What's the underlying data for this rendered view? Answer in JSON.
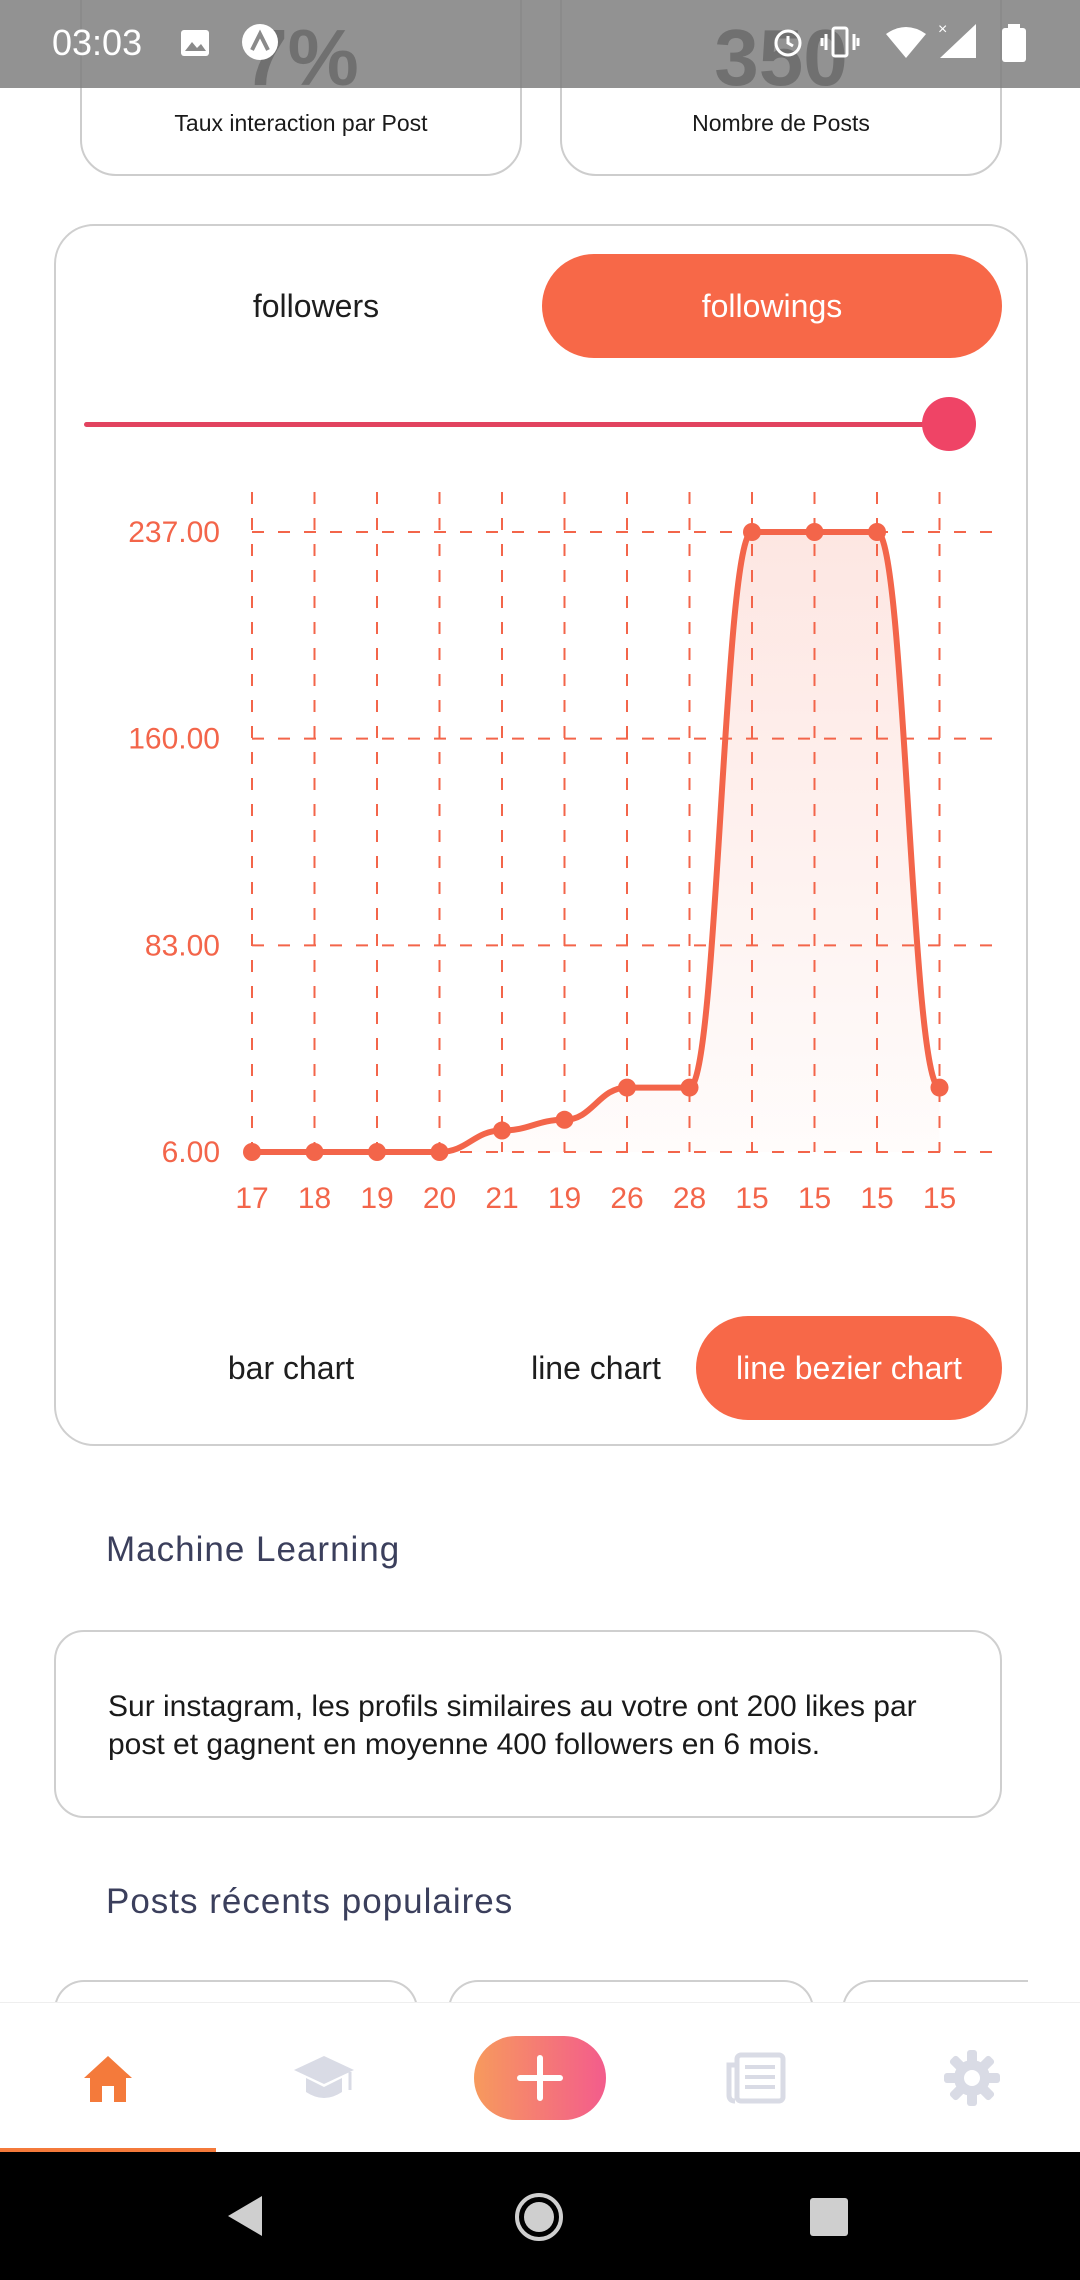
{
  "status_bar": {
    "time": "03:03"
  },
  "stats": [
    {
      "value": "7%",
      "label": "Taux interaction par Post"
    },
    {
      "value": "350",
      "label": "Nombre de Posts"
    }
  ],
  "toggle": {
    "followers_label": "followers",
    "followings_label": "followings",
    "active": "followings"
  },
  "slider": {
    "value": 1.0
  },
  "chart_data": {
    "type": "line",
    "style": "bezier",
    "categories": [
      "17",
      "18",
      "19",
      "20",
      "21",
      "19",
      "26",
      "28",
      "15",
      "15",
      "15",
      "15"
    ],
    "values": [
      6,
      6,
      6,
      6,
      14,
      18,
      30,
      30,
      237,
      237,
      237,
      30
    ],
    "yticks": [
      "6.00",
      "83.00",
      "160.00",
      "237.00"
    ],
    "ylim": [
      6,
      237
    ],
    "grid": true,
    "color": "#f3654a"
  },
  "chart_types": {
    "bar_label": "bar chart",
    "line_label": "line chart",
    "bezier_label": "line bezier chart",
    "active": "line bezier chart"
  },
  "machine_learning": {
    "title": "Machine Learning",
    "text": "Sur instagram, les profils similaires au votre  ont 200 likes par post et gagnent en moyenne 400 followers en 6 mois."
  },
  "popular_posts": {
    "title": "Posts récents populaires"
  },
  "bottom_nav": {
    "items": [
      "home-icon",
      "graduation-cap-icon",
      "add-icon",
      "news-icon",
      "settings-icon"
    ],
    "active": "home-icon",
    "accent": "#f47a3b"
  }
}
